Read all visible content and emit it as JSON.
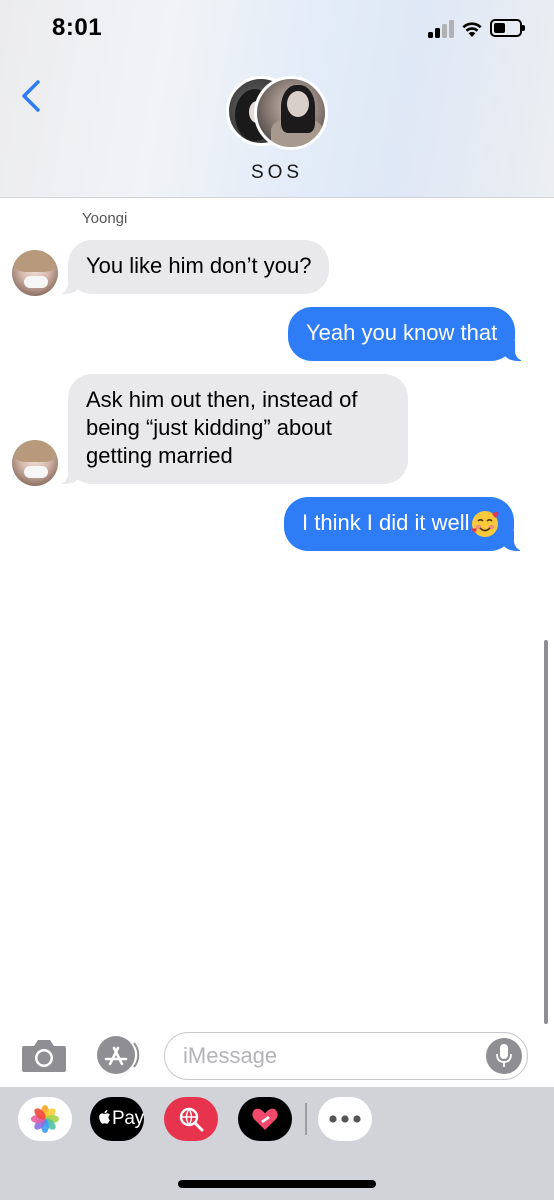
{
  "status_bar": {
    "time": "8:01",
    "icons": [
      "cellular-signal-icon",
      "wifi-icon",
      "battery-icon"
    ]
  },
  "header": {
    "back_icon": "chevron-left-icon",
    "group_name": "SOS"
  },
  "colors": {
    "outgoing_bubble": "#2e7cf6",
    "incoming_bubble": "#e9e9eb",
    "accent": "#2f7cf6"
  },
  "conversation": {
    "sender_name": "Yoongi",
    "messages": [
      {
        "direction": "incoming",
        "text": "You like him don’t you?"
      },
      {
        "direction": "outgoing",
        "text": "Yeah you know that"
      },
      {
        "direction": "incoming",
        "lines": [
          "Ask him out then, instead of",
          "being “just kidding” about",
          "getting married"
        ]
      },
      {
        "direction": "outgoing",
        "text": "I think I did it well",
        "emoji": "smiling-face-with-hearts-icon"
      }
    ]
  },
  "input_bar": {
    "placeholder": "iMessage",
    "value": "",
    "icons": [
      "camera-icon",
      "app-store-icon",
      "microphone-icon"
    ]
  },
  "app_drawer": {
    "pay_label": "Pay",
    "apps": [
      "photos-icon",
      "apple-pay-icon",
      "web-search-icon",
      "digital-touch-icon",
      "more-icon"
    ]
  }
}
